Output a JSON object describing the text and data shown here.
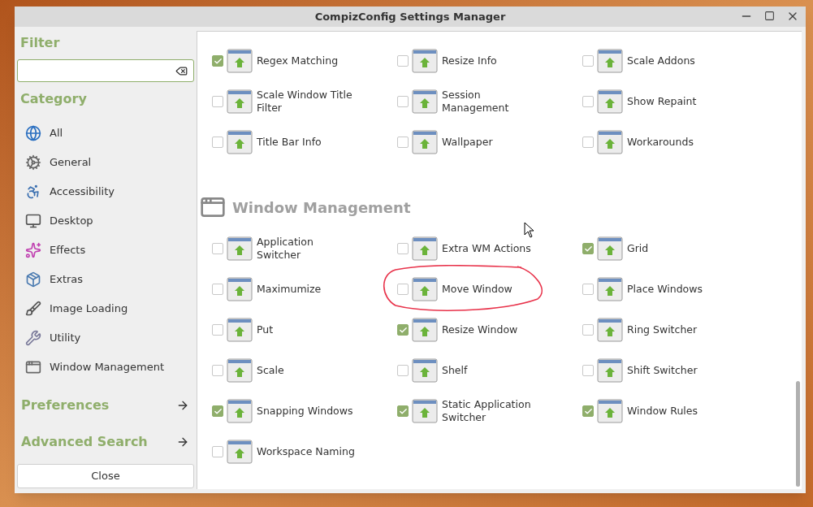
{
  "window": {
    "title": "CompizConfig Settings Manager"
  },
  "sidebar": {
    "filter_heading": "Filter",
    "category_heading": "Category",
    "categories": [
      {
        "label": "All"
      },
      {
        "label": "General"
      },
      {
        "label": "Accessibility"
      },
      {
        "label": "Desktop"
      },
      {
        "label": "Effects"
      },
      {
        "label": "Extras"
      },
      {
        "label": "Image Loading"
      },
      {
        "label": "Utility"
      },
      {
        "label": "Window Management"
      }
    ],
    "links": [
      {
        "label": "Preferences"
      },
      {
        "label": "Advanced Search"
      }
    ],
    "close_button": "Close"
  },
  "sections": [
    {
      "plugins": [
        {
          "label": "Regex Matching",
          "checked": true
        },
        {
          "label": "Resize Info",
          "checked": false
        },
        {
          "label": "Scale Addons",
          "checked": false
        },
        {
          "label": "Scale Window Title Filter",
          "checked": false
        },
        {
          "label": "Session Management",
          "checked": false
        },
        {
          "label": "Show Repaint",
          "checked": false
        },
        {
          "label": "Title Bar Info",
          "checked": false
        },
        {
          "label": "Wallpaper",
          "checked": false
        },
        {
          "label": "Workarounds",
          "checked": false
        }
      ]
    },
    {
      "title": "Window Management",
      "plugins": [
        {
          "label": "Application Switcher",
          "checked": false
        },
        {
          "label": "Extra WM Actions",
          "checked": false
        },
        {
          "label": "Grid",
          "checked": true
        },
        {
          "label": "Maximumize",
          "checked": false
        },
        {
          "label": "Move Window",
          "checked": false,
          "circled": true
        },
        {
          "label": "Place Windows",
          "checked": false
        },
        {
          "label": "Put",
          "checked": false
        },
        {
          "label": "Resize Window",
          "checked": true
        },
        {
          "label": "Ring Switcher",
          "checked": false
        },
        {
          "label": "Scale",
          "checked": false
        },
        {
          "label": "Shelf",
          "checked": false
        },
        {
          "label": "Shift Switcher",
          "checked": false
        },
        {
          "label": "Snapping Windows",
          "checked": true
        },
        {
          "label": "Static Application Switcher",
          "checked": true
        },
        {
          "label": "Window Rules",
          "checked": true
        },
        {
          "label": "Workspace Naming",
          "checked": false
        }
      ]
    }
  ]
}
